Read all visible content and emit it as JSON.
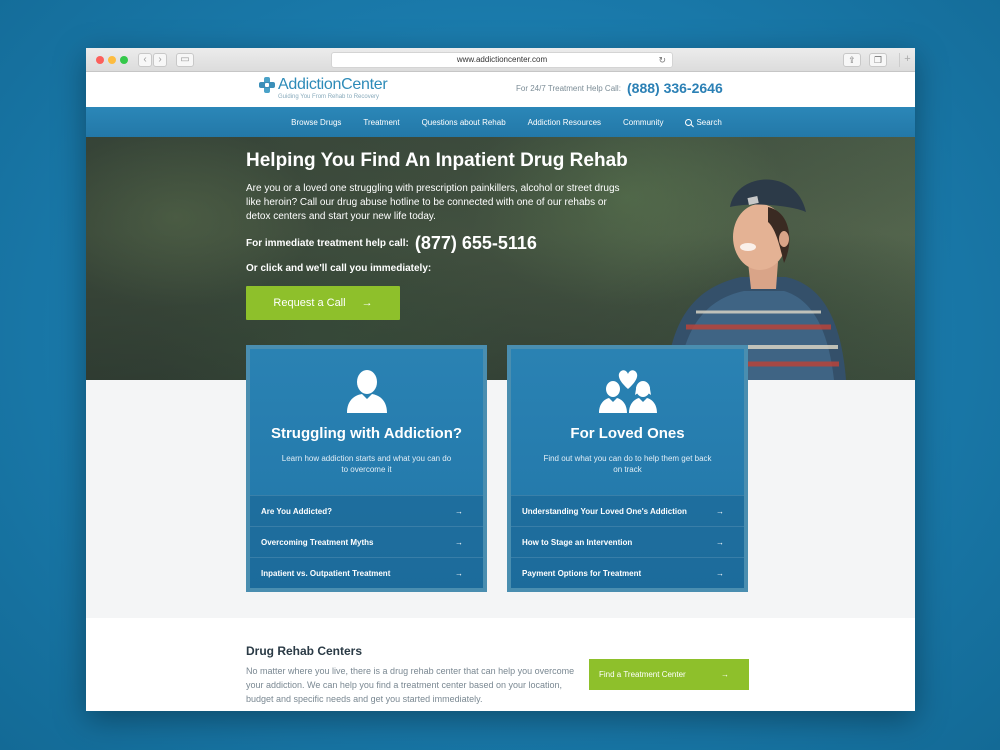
{
  "browser": {
    "url": "www.addictioncenter.com"
  },
  "header": {
    "logo_text_1": "Addiction",
    "logo_text_2": "Center",
    "tagline": "Guiding You From Rehab to Recovery",
    "helpline_label": "For 24/7 Treatment Help Call:",
    "helpline_number": "(888) 336-2646"
  },
  "nav": {
    "items": [
      "Browse Drugs",
      "Treatment",
      "Questions about Rehab",
      "Addiction Resources",
      "Community"
    ],
    "search_label": "Search"
  },
  "hero": {
    "title": "Helping You Find An Inpatient Drug Rehab",
    "description": "Are you or a loved one struggling with prescription painkillers, alcohol or street drugs like heroin? Call our drug abuse hotline to be connected with one of our rehabs or detox centers and start your new life today.",
    "help_label": "For immediate treatment help call:",
    "help_number": "(877) 655-5116",
    "call_back_text": "Or click and we'll call you immediately:",
    "cta_label": "Request a Call"
  },
  "cards": [
    {
      "icon": "person-icon",
      "title": "Struggling with Addiction?",
      "subtitle": "Learn how addiction starts and what you can do to overcome it",
      "links": [
        "Are You Addicted?",
        "Overcoming Treatment Myths",
        "Inpatient vs. Outpatient Treatment"
      ]
    },
    {
      "icon": "family-heart-icon",
      "title": "For Loved Ones",
      "subtitle": "Find out what you can do to help them get back on track",
      "links": [
        "Understanding Your Loved One's Addiction",
        "How to Stage an Intervention",
        "Payment Options for Treatment"
      ]
    }
  ],
  "drug_rehab": {
    "title": "Drug Rehab Centers",
    "text": "No matter where you live, there is a drug rehab center that can help you overcome your addiction. We can help you find a treatment center based on your location, budget and specific needs and get you started immediately.",
    "button_label": "Find a Treatment Center"
  },
  "colors": {
    "background": "#1a7fb0",
    "primary_blue": "#2378a8",
    "accent_green": "#8ec02b"
  }
}
